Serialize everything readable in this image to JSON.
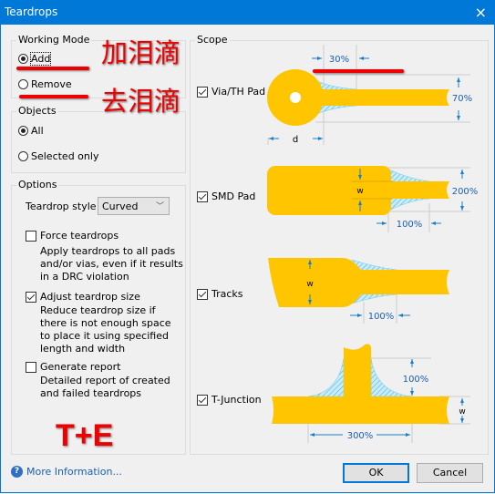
{
  "window": {
    "title": "Teardrops",
    "close_icon": "×"
  },
  "working_mode": {
    "label": "Working Mode",
    "options": [
      {
        "label": "Add",
        "selected": true
      },
      {
        "label": "Remove",
        "selected": false
      }
    ]
  },
  "objects": {
    "label": "Objects",
    "options": [
      {
        "label": "All",
        "selected": true
      },
      {
        "label": "Selected only",
        "selected": false
      }
    ]
  },
  "options": {
    "label": "Options",
    "teardrop_style_label": "Teardrop style",
    "teardrop_style_value": "Curved",
    "force": {
      "label": "Force teardrops",
      "checked": false,
      "desc": [
        "Apply teardrops to all pads",
        "and/or vias, even if it results",
        "in a DRC violation"
      ]
    },
    "adjust": {
      "label": "Adjust teardrop size",
      "checked": true,
      "desc": [
        "Reduce teardrop size if",
        "there is not enough space",
        "to place it using specified",
        "length and width"
      ]
    },
    "report": {
      "label": "Generate report",
      "checked": false,
      "desc": [
        "Detailed report of created",
        "and failed teardrops"
      ]
    }
  },
  "scope": {
    "label": "Scope",
    "via": {
      "label": "Via/TH Pad",
      "checked": true,
      "length": "30%",
      "width": "70%",
      "dim": "d"
    },
    "smd": {
      "label": "SMD Pad",
      "checked": true,
      "length": "100%",
      "width": "200%",
      "dim": "w"
    },
    "tracks": {
      "label": "Tracks",
      "checked": true,
      "length": "100%",
      "dim": "w"
    },
    "tjunction": {
      "label": "T-Junction",
      "checked": true,
      "length": "300%",
      "height": "100%",
      "dim": "w"
    }
  },
  "annotations": {
    "add_cn": "加泪滴",
    "remove_cn": "去泪滴",
    "watermark": "T+E"
  },
  "footer": {
    "more_info": "More Information...",
    "help_icon": "?",
    "ok": "OK",
    "cancel": "Cancel"
  },
  "colors": {
    "titlebar": "#0078d7",
    "copper": "#ffc600",
    "teardrop": "#7ecde8",
    "dimension": "#1a7fc8",
    "annotation": "#ee0000"
  }
}
